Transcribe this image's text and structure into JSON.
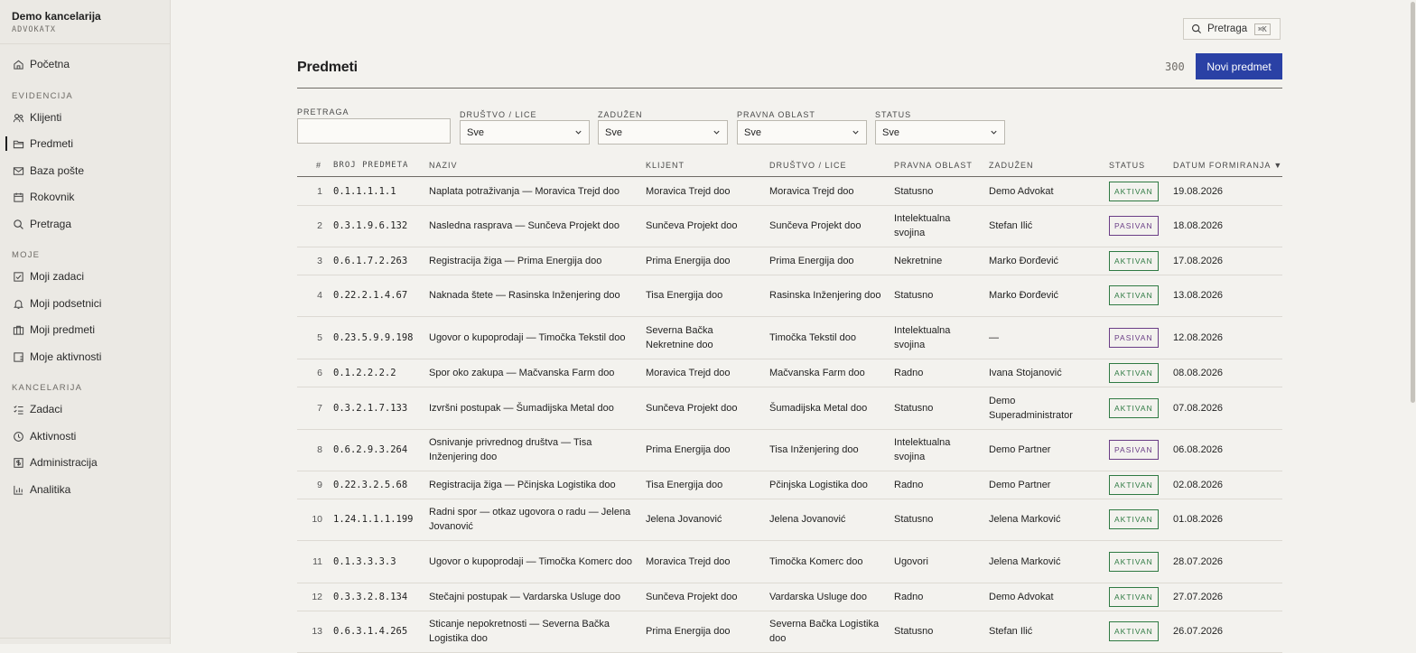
{
  "brand": {
    "name": "Demo kancelarija",
    "sub": "ADVOKATX"
  },
  "nav": {
    "home": "Početna",
    "sections": {
      "evidencija": "EVIDENCIJA",
      "moje": "MOJE",
      "kancelarija": "KANCELARIJA"
    },
    "items": [
      {
        "label": "Klijenti",
        "icon": "users-icon"
      },
      {
        "label": "Predmeti",
        "icon": "folder-icon",
        "active": true
      },
      {
        "label": "Baza pošte",
        "icon": "mail-icon"
      },
      {
        "label": "Rokovnik",
        "icon": "calendar-icon"
      },
      {
        "label": "Pretraga",
        "icon": "search-icon"
      },
      {
        "label": "Moji zadaci",
        "icon": "checkbox-icon"
      },
      {
        "label": "Moji podsetnici",
        "icon": "bell-icon"
      },
      {
        "label": "Moji predmeti",
        "icon": "briefcase-icon"
      },
      {
        "label": "Moje aktivnosti",
        "icon": "activity-icon"
      },
      {
        "label": "Zadaci",
        "icon": "list-check-icon"
      },
      {
        "label": "Aktivnosti",
        "icon": "clock-icon"
      },
      {
        "label": "Administracija",
        "icon": "admin-icon"
      },
      {
        "label": "Analitika",
        "icon": "chart-icon"
      }
    ]
  },
  "header": {
    "search_label": "Pretraga",
    "search_kbd": "⌘K",
    "title": "Predmeti",
    "count": "300",
    "new_button": "Novi predmet"
  },
  "filters": {
    "search_label": "PRETRAGA",
    "search_value": "",
    "selects": [
      {
        "label": "DRUŠTVO / LICE",
        "value": "Sve"
      },
      {
        "label": "ZADUŽEN",
        "value": "Sve"
      },
      {
        "label": "PRAVNA OBLAST",
        "value": "Sve"
      },
      {
        "label": "STATUS",
        "value": "Sve"
      }
    ]
  },
  "table": {
    "columns": [
      "#",
      "BROJ PREDMETA",
      "NAZIV",
      "KLIJENT",
      "DRUŠTVO / LICE",
      "PRAVNA OBLAST",
      "ZADUŽEN",
      "STATUS",
      "DATUM FORMIRANJA ▼"
    ],
    "rows": [
      [
        "1",
        "0.1.1.1.1.1",
        "Naplata potraživanja — Moravica Trejd doo",
        "Moravica Trejd doo",
        "Moravica Trejd doo",
        "Statusno",
        "Demo Advokat",
        "AKTIVAN",
        "19.08.2026"
      ],
      [
        "2",
        "0.3.1.9.6.132",
        "Nasledna rasprava — Sunčeva Projekt doo",
        "Sunčeva Projekt doo",
        "Sunčeva Projekt doo",
        "Intelektualna svojina",
        "Stefan Ilić",
        "PASIVAN",
        "18.08.2026"
      ],
      [
        "3",
        "0.6.1.7.2.263",
        "Registracija žiga — Prima Energija doo",
        "Prima Energija doo",
        "Prima Energija doo",
        "Nekretnine",
        "Marko Đorđević",
        "AKTIVAN",
        "17.08.2026"
      ],
      [
        "4",
        "0.22.2.1.4.67",
        "Naknada štete — Rasinska Inženjering doo",
        "Tisa Energija doo",
        "Rasinska Inženjering doo",
        "Statusno",
        "Marko Đorđević",
        "AKTIVAN",
        "13.08.2026"
      ],
      [
        "5",
        "0.23.5.9.9.198",
        "Ugovor o kupoprodaji — Timočka Tekstil doo",
        "Severna Bačka Nekretnine doo",
        "Timočka Tekstil doo",
        "Intelektualna svojina",
        "—",
        "PASIVAN",
        "12.08.2026"
      ],
      [
        "6",
        "0.1.2.2.2.2",
        "Spor oko zakupa — Mačvanska Farm doo",
        "Moravica Trejd doo",
        "Mačvanska Farm doo",
        "Radno",
        "Ivana Stojanović",
        "AKTIVAN",
        "08.08.2026"
      ],
      [
        "7",
        "0.3.2.1.7.133",
        "Izvršni postupak — Šumadijska Metal doo",
        "Sunčeva Projekt doo",
        "Šumadijska Metal doo",
        "Statusno",
        "Demo Superadministrator",
        "AKTIVAN",
        "07.08.2026"
      ],
      [
        "8",
        "0.6.2.9.3.264",
        "Osnivanje privrednog društva — Tisa Inženjering doo",
        "Prima Energija doo",
        "Tisa Inženjering doo",
        "Intelektualna svojina",
        "Demo Partner",
        "PASIVAN",
        "06.08.2026"
      ],
      [
        "9",
        "0.22.3.2.5.68",
        "Registracija žiga — Pčinjska Logistika doo",
        "Tisa Energija doo",
        "Pčinjska Logistika doo",
        "Radno",
        "Demo Partner",
        "AKTIVAN",
        "02.08.2026"
      ],
      [
        "10",
        "1.24.1.1.1.199",
        "Radni spor — otkaz ugovora o radu — Jelena Jovanović",
        "Jelena Jovanović",
        "Jelena Jovanović",
        "Statusno",
        "Jelena Marković",
        "AKTIVAN",
        "01.08.2026"
      ],
      [
        "11",
        "0.1.3.3.3.3",
        "Ugovor o kupoprodaji — Timočka Komerc doo",
        "Moravica Trejd doo",
        "Timočka Komerc doo",
        "Ugovori",
        "Jelena Marković",
        "AKTIVAN",
        "28.07.2026"
      ],
      [
        "12",
        "0.3.3.2.8.134",
        "Stečajni postupak — Vardarska Usluge doo",
        "Sunčeva Projekt doo",
        "Vardarska Usluge doo",
        "Radno",
        "Demo Advokat",
        "AKTIVAN",
        "27.07.2026"
      ],
      [
        "13",
        "0.6.3.1.4.265",
        "Sticanje nepokretnosti — Severna Bačka Logistika doo",
        "Prima Energija doo",
        "Severna Bačka Logistika doo",
        "Statusno",
        "Stefan Ilić",
        "AKTIVAN",
        "26.07.2026"
      ]
    ]
  }
}
